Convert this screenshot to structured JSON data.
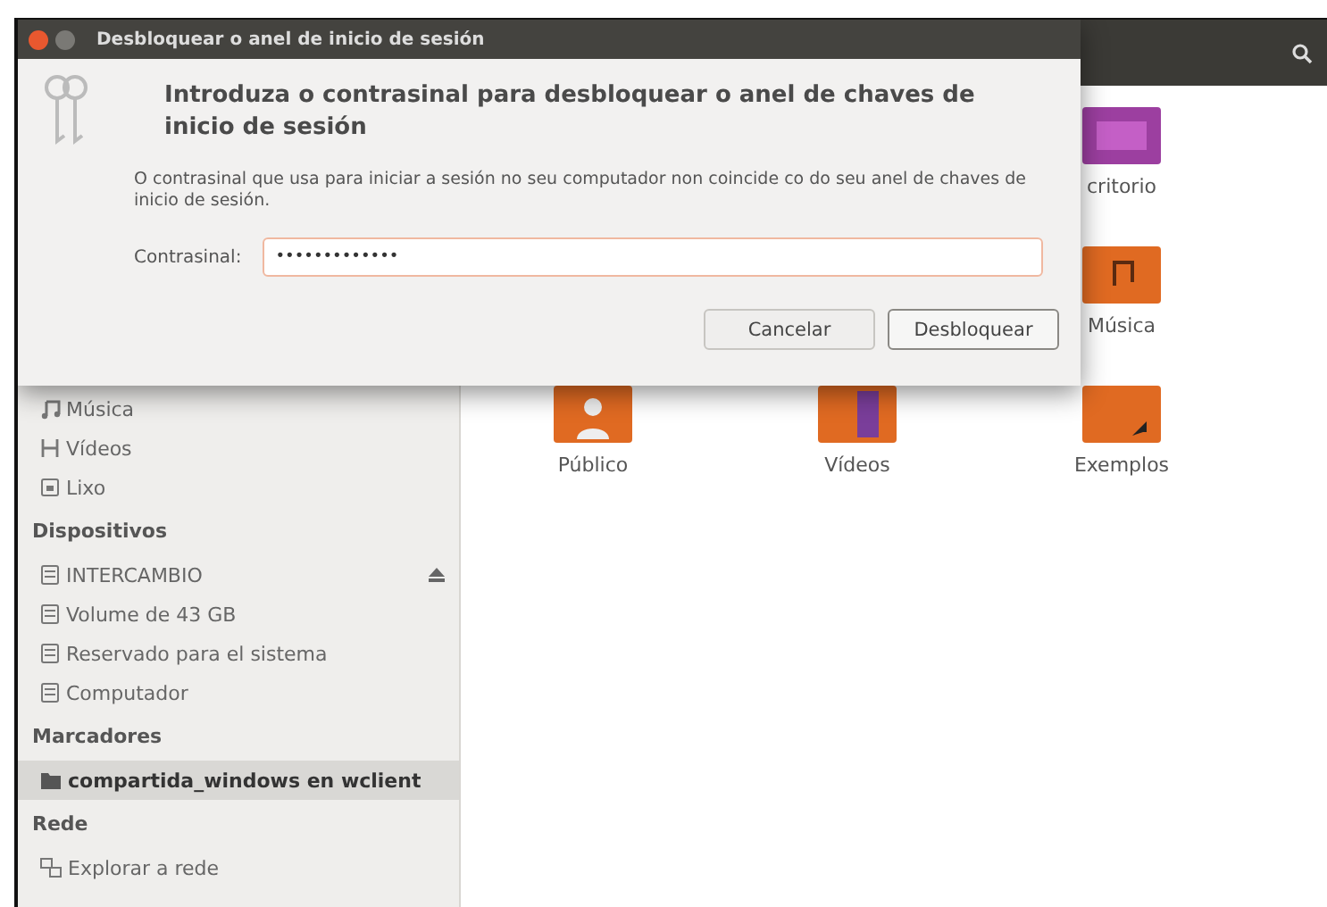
{
  "file_manager": {
    "sidebar": {
      "sections": [
        {
          "items": [
            {
              "label": "Música",
              "kind": "music",
              "selected": false,
              "eject": false
            },
            {
              "label": "Vídeos",
              "kind": "video",
              "selected": false,
              "eject": false
            },
            {
              "label": "Lixo",
              "kind": "trash",
              "selected": false,
              "eject": false
            }
          ]
        },
        {
          "title": "Dispositivos",
          "items": [
            {
              "label": "INTERCAMBIO",
              "kind": "drive",
              "selected": false,
              "eject": true
            },
            {
              "label": "Volume de 43 GB",
              "kind": "drive",
              "selected": false,
              "eject": false
            },
            {
              "label": "Reservado para el sistema",
              "kind": "drive",
              "selected": false,
              "eject": false
            },
            {
              "label": "Computador",
              "kind": "drive",
              "selected": false,
              "eject": false
            }
          ]
        },
        {
          "title": "Marcadores",
          "items": [
            {
              "label": "compartida_windows en wclient",
              "kind": "folder",
              "selected": true,
              "eject": false
            }
          ]
        },
        {
          "title": "Rede",
          "items": [
            {
              "label": "Explorar a rede",
              "kind": "network",
              "selected": false,
              "eject": false
            }
          ]
        }
      ]
    },
    "folders": [
      {
        "label": "critorio",
        "kind": "desktop"
      },
      {
        "label": "Música",
        "kind": "music"
      },
      {
        "label": "Público",
        "kind": "public"
      },
      {
        "label": "Vídeos",
        "kind": "videos"
      },
      {
        "label": "Exemplos",
        "kind": "examples"
      }
    ]
  },
  "dialog": {
    "title": "Desbloquear o anel de inicio de sesión",
    "heading": "Introduza o contrasinal para desbloquear o anel de chaves de inicio de sesión",
    "message": "O contrasinal que usa para iniciar a sesión no seu computador non coincide co do seu anel de chaves de inicio de sesión.",
    "field": {
      "label": "Contrasinal:",
      "value": "•••••••••••••"
    },
    "buttons": [
      {
        "label": "Cancelar",
        "hovered": false
      },
      {
        "label": "Desbloquear",
        "hovered": true
      }
    ]
  }
}
